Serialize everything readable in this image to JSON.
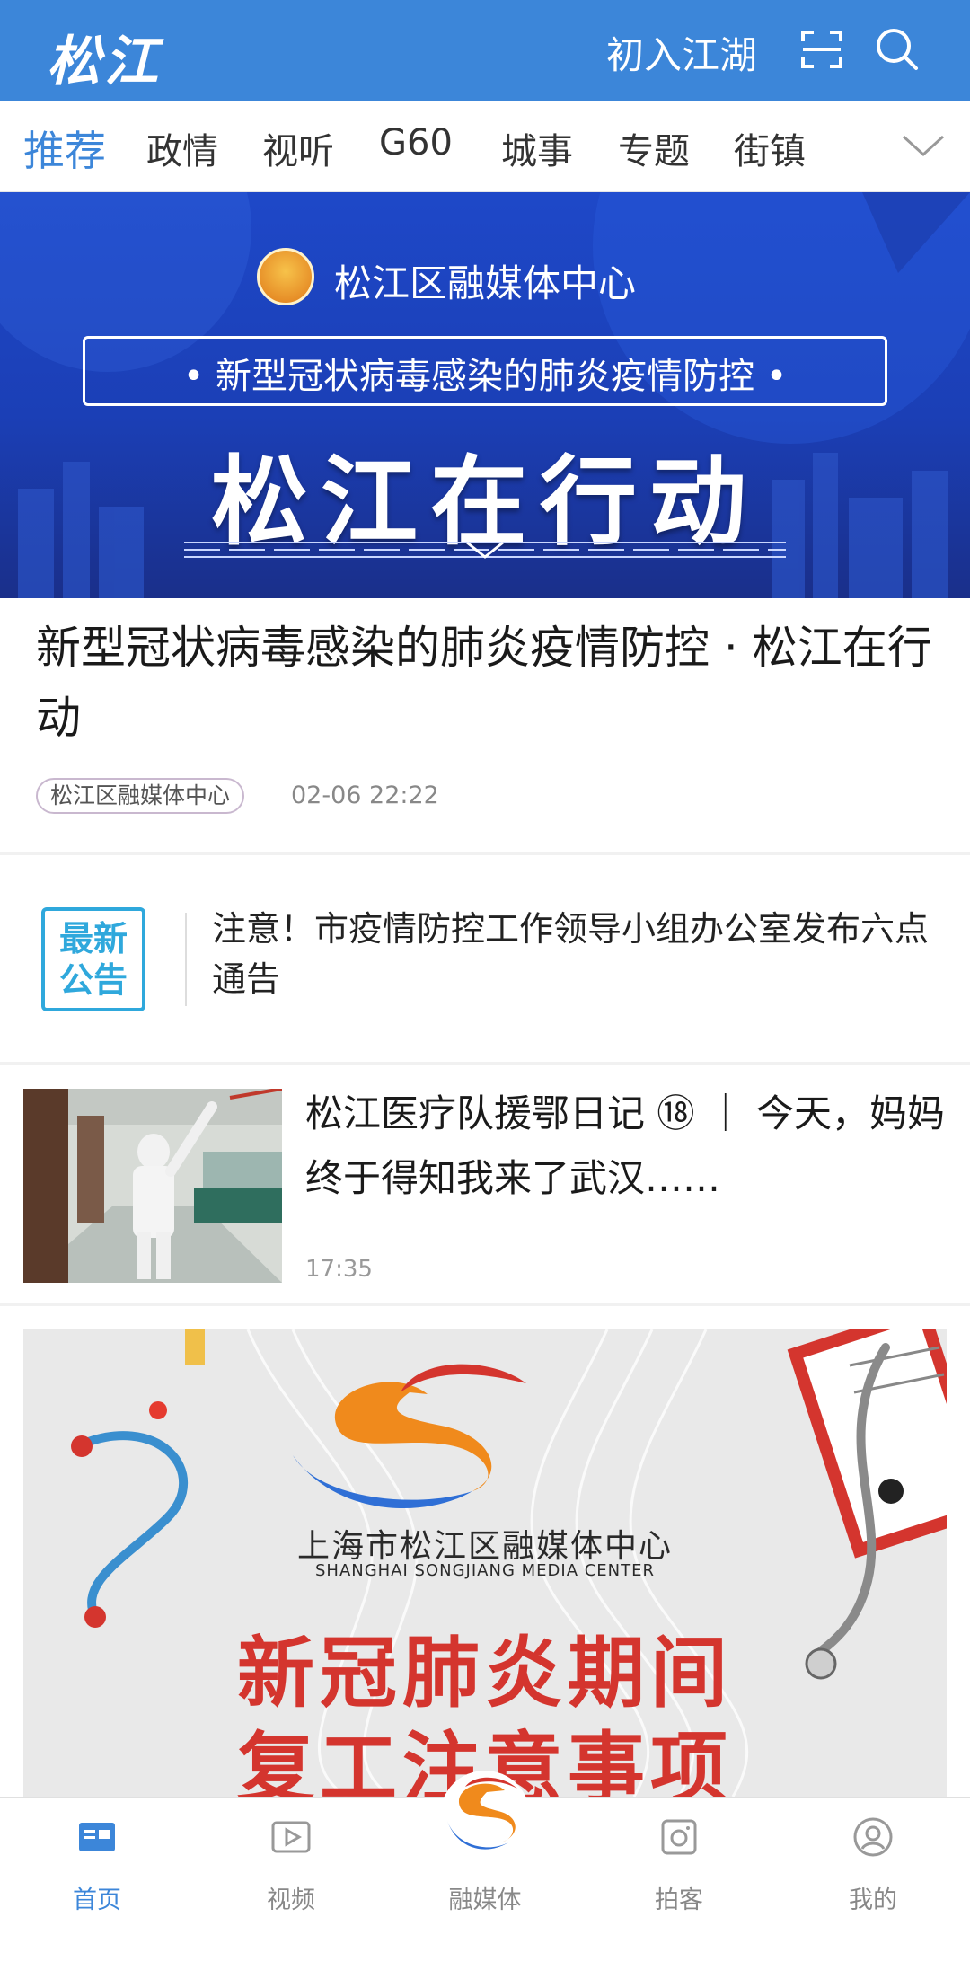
{
  "header": {
    "logo_text": "松江",
    "link_label": "初入江湖",
    "scan_icon": "scan-icon",
    "search_icon": "search-icon",
    "background_color": "#3c86d9"
  },
  "tabs": [
    {
      "label": "推荐",
      "active": true
    },
    {
      "label": "政情",
      "active": false
    },
    {
      "label": "视听",
      "active": false
    },
    {
      "label": "G60",
      "active": false
    },
    {
      "label": "城事",
      "active": false
    },
    {
      "label": "专题",
      "active": false
    },
    {
      "label": "街镇",
      "active": false
    }
  ],
  "tabs_more_icon": "chevron-down-icon",
  "hero": {
    "org": "松江区融媒体中心",
    "subtitle": "• 新型冠状病毒感染的肺炎疫情防控 •",
    "title": "松江在行动"
  },
  "article1": {
    "title": "新型冠状病毒感染的肺炎疫情防控 · 松江在行动",
    "source": "松江区融媒体中心",
    "time": "02-06 22:22"
  },
  "notice": {
    "badge": "最新\n公告",
    "text": "注意！市疫情防控工作领导小组办公室发布六点通告",
    "accent_color": "#2fa8dc"
  },
  "article2": {
    "title": "松江医疗队援鄂日记 ⑱ ｜ 今天，妈妈终于得知我来了武汉……",
    "time": "17:35"
  },
  "poster": {
    "org": "上海市松江区融媒体中心",
    "org_en": "SHANGHAI SONGJIANG MEDIA CENTER",
    "line1": "新冠肺炎期间",
    "line2": "复工注意事项",
    "title_color": "#d4352e"
  },
  "bottom_nav": [
    {
      "label": "首页",
      "icon": "home-icon",
      "active": true
    },
    {
      "label": "视频",
      "icon": "video-icon",
      "active": false
    },
    {
      "label": "融媒体",
      "icon": "media-logo-icon",
      "active": false
    },
    {
      "label": "拍客",
      "icon": "camera-icon",
      "active": false
    },
    {
      "label": "我的",
      "icon": "profile-icon",
      "active": false
    }
  ]
}
